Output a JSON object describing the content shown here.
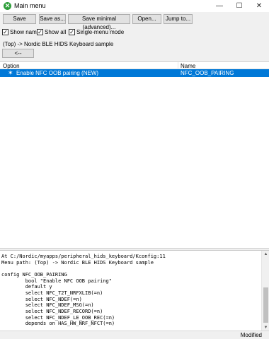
{
  "window": {
    "title": "Main menu",
    "minimize": "—",
    "maximize": "☐",
    "close": "✕"
  },
  "toolbar": {
    "save": "Save",
    "save_as": "Save as...",
    "save_minimal": "Save minimal (advanced)...",
    "open": "Open...",
    "jump_to": "Jump to..."
  },
  "options": {
    "show_name": {
      "label": "Show name",
      "checked": true
    },
    "show_all": {
      "label": "Show all",
      "checked": true
    },
    "single_menu_mode": {
      "label": "Single-menu mode",
      "checked": true
    }
  },
  "breadcrumb": "(Top) -> Nordic BLE HIDS Keyboard sample",
  "back_button": "<--",
  "tree": {
    "columns": {
      "option": "Option",
      "name": "Name"
    },
    "rows": [
      {
        "option": "Enable NFC OOB pairing (NEW)",
        "name": "NFC_OOB_PAIRING",
        "selected": true,
        "icon": "star-icon"
      }
    ]
  },
  "help_text": "At C:/Nordic/myapps/peripheral_hids_keyboard/Kconfig:11\nMenu path: (Top) -> Nordic BLE HIDS Keyboard sample\n\nconfig NFC_OOB_PAIRING\n        bool \"Enable NFC OOB pairing\"\n        default y\n        select NFC_T2T_NRFXLIB(=n)\n        select NFC_NDEF(=n)\n        select NFC_NDEF_MSG(=n)\n        select NFC_NDEF_RECORD(=n)\n        select NFC_NDEF_LE_OOB_REC(=n)\n        depends on HAS_HW_NRF_NFCT(=n)",
  "status": "Modified",
  "colors": {
    "selection": "#0078d7",
    "app_icon": "#2e9e3a"
  }
}
